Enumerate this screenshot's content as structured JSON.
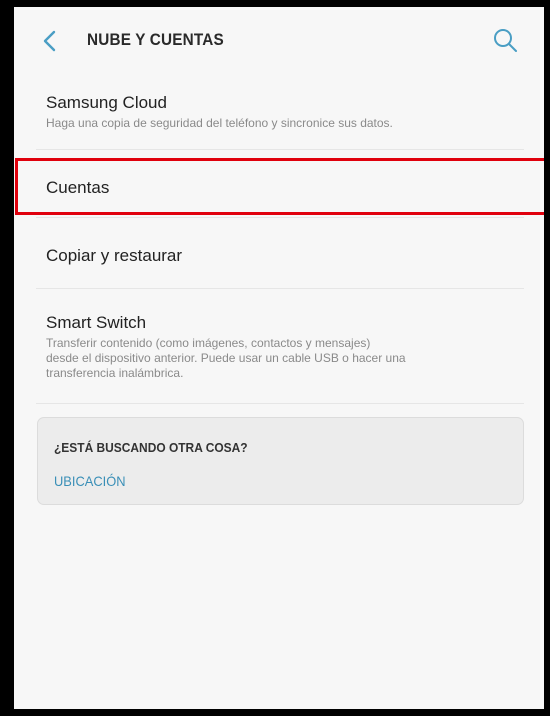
{
  "header": {
    "title": "NUBE Y CUENTAS",
    "back_icon": "chevron-left-icon",
    "search_icon": "search-icon",
    "accent_color": "#4a9ec4"
  },
  "items": [
    {
      "title": "Samsung Cloud",
      "subtitle": "Haga una copia de seguridad del teléfono y sincronice sus datos."
    },
    {
      "title": "Cuentas",
      "highlighted": true,
      "highlight_color": "#e0000d"
    },
    {
      "title": "Copiar y restaurar"
    },
    {
      "title": "Smart Switch",
      "subtitle_lines": [
        "Transferir contenido (como imágenes, contactos y mensajes)",
        "desde el dispositivo anterior. Puede usar un cable USB o hacer una",
        "transferencia inalámbrica."
      ]
    }
  ],
  "suggestions": {
    "title": "¿ESTÁ BUSCANDO OTRA COSA?",
    "link": "UBICACIÓN",
    "link_color": "#3a8fb7"
  }
}
